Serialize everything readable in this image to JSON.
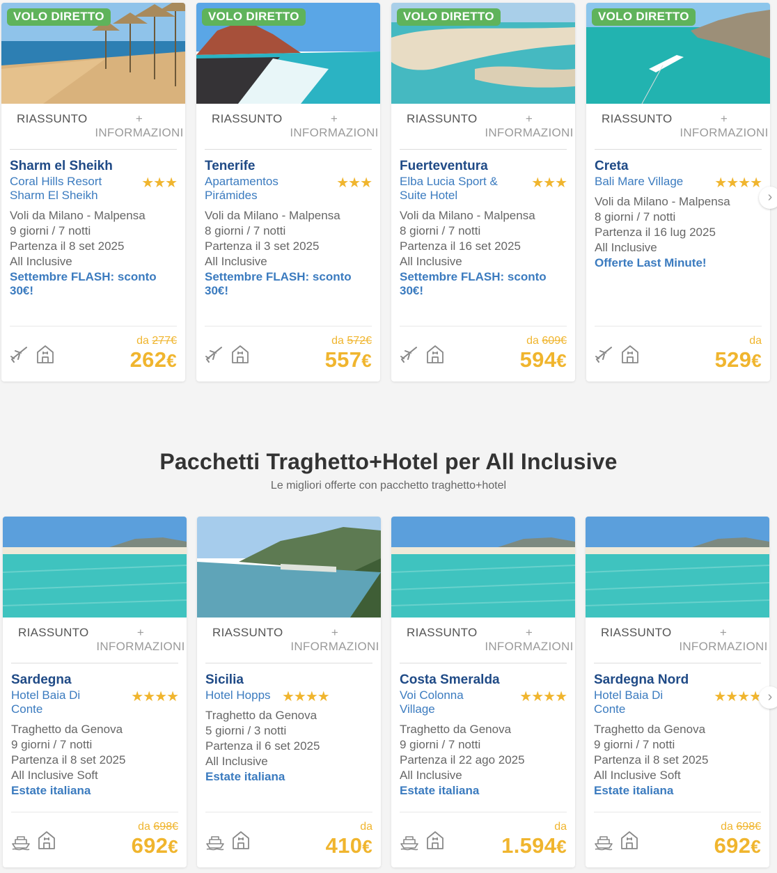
{
  "section2": {
    "title": "Pacchetti Traghetto+Hotel per All Inclusive",
    "subtitle": "Le migliori offerte con pacchetto traghetto+hotel"
  },
  "tabs": {
    "summary": "RIASSUNTO",
    "more_plus": "+",
    "more": "INFORMAZIONI"
  },
  "from_label": "da",
  "flight_cards": [
    {
      "badge": "VOLO DIRETTO",
      "dest": "Sharm el Sheikh",
      "hotel": "Coral Hills Resort Sharm El Sheikh",
      "stars": "★★★",
      "origin": "Voli da Milano - Malpensa",
      "duration": "9 giorni / 7 notti",
      "departure": "Partenza il 8 set 2025",
      "board": "All Inclusive",
      "promo": "Settembre FLASH: sconto 30€!",
      "old_price": "277€",
      "price": "262",
      "currency": "€"
    },
    {
      "badge": "VOLO DIRETTO",
      "dest": "Tenerife",
      "hotel": "Apartamentos Pirámides",
      "stars": "★★★",
      "origin": "Voli da Milano - Malpensa",
      "duration": "8 giorni / 7 notti",
      "departure": "Partenza il 3 set 2025",
      "board": "All Inclusive",
      "promo": "Settembre FLASH: sconto 30€!",
      "old_price": "572€",
      "price": "557",
      "currency": "€"
    },
    {
      "badge": "VOLO DIRETTO",
      "dest": "Fuerteventura",
      "hotel": "Elba Lucia Sport & Suite Hotel",
      "stars": "★★★",
      "origin": "Voli da Milano - Malpensa",
      "duration": "8 giorni / 7 notti",
      "departure": "Partenza il 16 set 2025",
      "board": "All Inclusive",
      "promo": "Settembre FLASH: sconto 30€!",
      "old_price": "609€",
      "price": "594",
      "currency": "€"
    },
    {
      "badge": "VOLO DIRETTO",
      "dest": "Creta",
      "hotel": "Bali Mare Village",
      "stars": "★★★★",
      "origin": "Voli da Milano - Malpensa",
      "duration": "8 giorni / 7 notti",
      "departure": "Partenza il 16 lug 2025",
      "board": "All Inclusive",
      "promo": "Offerte Last Minute!",
      "old_price": "",
      "price": "529",
      "currency": "€"
    }
  ],
  "ferry_cards": [
    {
      "dest": "Sardegna",
      "hotel": "Hotel Baia Di Conte",
      "stars": "★★★★",
      "origin": "Traghetto da Genova",
      "duration": "9 giorni / 7 notti",
      "departure": "Partenza il 8 set 2025",
      "board": "All Inclusive Soft",
      "promo": "Estate italiana",
      "old_price": "698€",
      "price": "692",
      "currency": "€"
    },
    {
      "dest": "Sicilia",
      "hotel": "Hotel Hopps",
      "stars": "★★★★",
      "origin": "Traghetto da Genova",
      "duration": "5 giorni / 3 notti",
      "departure": "Partenza il 6 set 2025",
      "board": "All Inclusive",
      "promo": "Estate italiana",
      "old_price": "",
      "price": "410",
      "currency": "€"
    },
    {
      "dest": "Costa Smeralda",
      "hotel": "Voi Colonna Village",
      "stars": "★★★★",
      "origin": "Traghetto da Genova",
      "duration": "9 giorni / 7 notti",
      "departure": "Partenza il 22 ago 2025",
      "board": "All Inclusive",
      "promo": "Estate italiana",
      "old_price": "",
      "price": "1.594",
      "currency": "€"
    },
    {
      "dest": "Sardegna Nord",
      "hotel": "Hotel Baia Di Conte",
      "stars": "★★★★",
      "origin": "Traghetto da Genova",
      "duration": "9 giorni / 7 notti",
      "departure": "Partenza il 8 set 2025",
      "board": "All Inclusive Soft",
      "promo": "Estate italiana",
      "old_price": "698€",
      "price": "692",
      "currency": "€"
    }
  ],
  "carousel_next": "›",
  "colors": {
    "accent_blue": "#3b7bbf",
    "title_blue": "#1f4a86",
    "price_orange": "#f0b52e",
    "badge_green": "#5fb35b"
  },
  "icons": {
    "flight": "airplane-icon",
    "hotel": "hotel-icon",
    "ferry": "ferry-icon",
    "next": "chevron-right-icon"
  }
}
